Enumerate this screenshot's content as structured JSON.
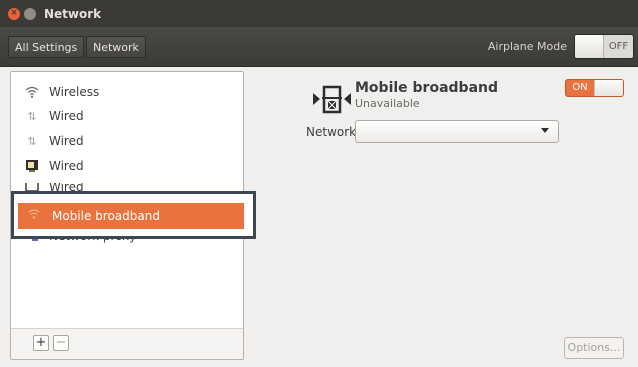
{
  "window": {
    "title": "Network"
  },
  "toolbar": {
    "breadcrumb_all": "All Settings",
    "breadcrumb_current": "Network",
    "airplane_label": "Airplane Mode",
    "airplane_state": "OFF"
  },
  "sidebar": {
    "items": [
      {
        "label": "Wireless",
        "icon": "wifi-icon"
      },
      {
        "label": "Wired",
        "icon": "wired-arrows-icon"
      },
      {
        "label": "Wired",
        "icon": "wired-arrows-icon"
      },
      {
        "label": "Wired",
        "icon": "display-icon"
      },
      {
        "label": "Wired",
        "icon": "monitor-icon"
      },
      {
        "label": "Network proxy",
        "icon": "proxy-icon"
      }
    ],
    "selected": {
      "label": "Mobile broadband",
      "icon": "signal-icon"
    },
    "add_label": "+",
    "remove_label": "−"
  },
  "detail": {
    "device_name": "Mobile broadband",
    "status": "Unavailable",
    "switch_state": "ON",
    "network_label": "Network",
    "network_value": "",
    "options_label": "Options..."
  },
  "colors": {
    "accent": "#e8733f",
    "titlebar": "#3b3a36",
    "highlight_frame": "#3c4751"
  }
}
